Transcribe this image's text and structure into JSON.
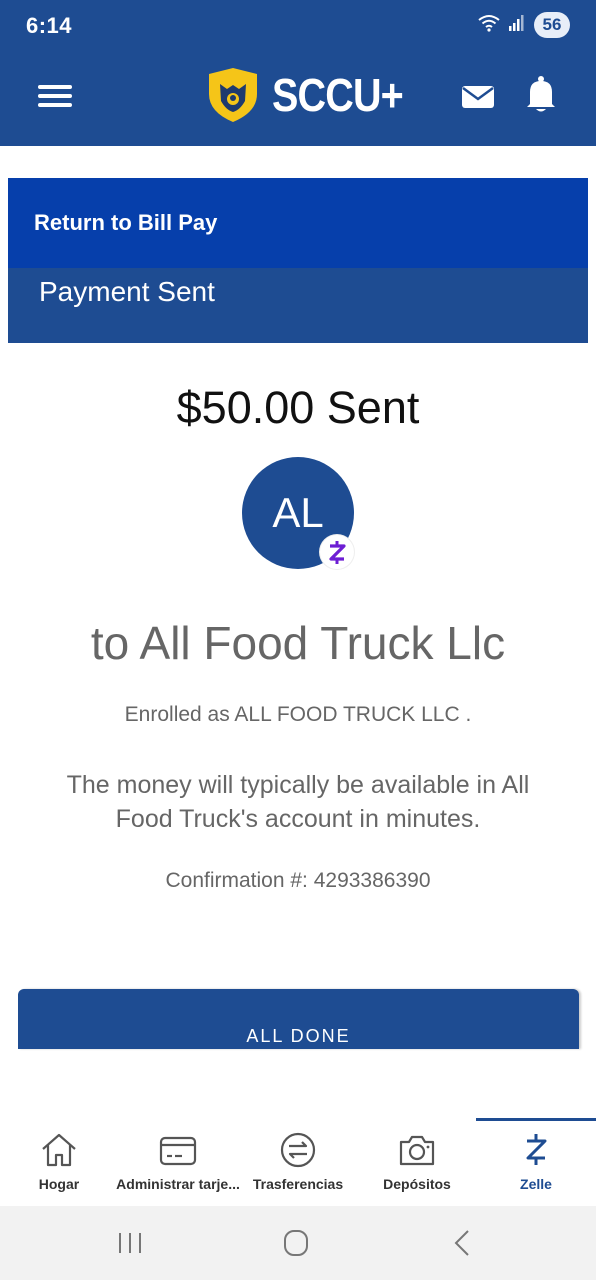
{
  "status_bar": {
    "time": "6:14",
    "battery": "56"
  },
  "header": {
    "brand": "SCCU+"
  },
  "panel": {
    "return_link": "Return to Bill Pay",
    "title": "Payment Sent"
  },
  "payment": {
    "amount_text": "$50.00 Sent",
    "avatar_initials": "AL",
    "recipient_text": "to All Food Truck Llc",
    "enrolled_text": "Enrolled as ALL FOOD TRUCK LLC .",
    "availability_text": "The money will typically be available in All Food Truck's account in minutes.",
    "confirmation_text": "Confirmation #: 4293386390"
  },
  "actions": {
    "all_done_label": "ALL DONE"
  },
  "bottom_nav": {
    "items": [
      {
        "label": "Hogar",
        "icon": "home-icon"
      },
      {
        "label": "Administrar tarje...",
        "icon": "card-icon"
      },
      {
        "label": "Trasferencias",
        "icon": "transfer-icon"
      },
      {
        "label": "Depósitos",
        "icon": "camera-icon"
      },
      {
        "label": "Zelle",
        "icon": "zelle-icon"
      }
    ],
    "active": "Zelle"
  },
  "colors": {
    "primary": "#1e4c92",
    "link_bar": "#063fab",
    "text_muted": "#666666",
    "zelle": "#6d1ed4",
    "shield": "#f5c518"
  }
}
